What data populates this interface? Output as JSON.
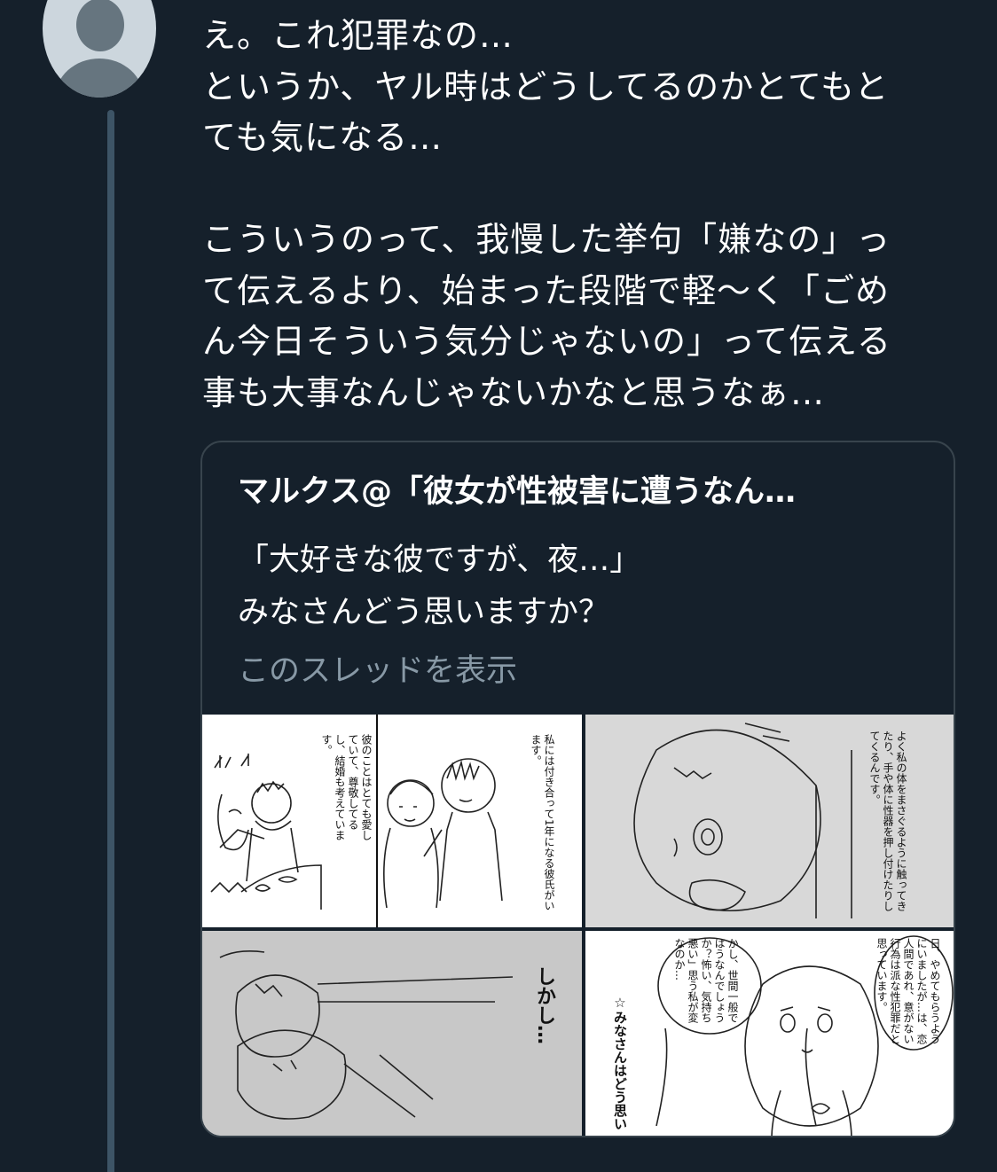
{
  "tweet": {
    "text": "え。これ犯罪なの…\nというか、ヤル時はどうしてるのかとてもと\nても気になる…\n\nこういうのって、我慢した挙句「嫌なの」っ\nて伝えるより、始まった段階で軽〜く「ごめ\nん今日そういう気分じゃないの」って伝える\n事も大事なんじゃないかなと思うなぁ…"
  },
  "quote": {
    "author": "マルクス@「彼女が性被害に遭うなん…",
    "text": "「大好きな彼ですが、夜…」\nみなさんどう思いますか？",
    "show_thread": "このスレッドを表示"
  },
  "manga": {
    "panel1_caption_a": "私には付き合って1年になる彼氏がいます。",
    "panel1_caption_b": "彼のことはとても愛していて、尊敬してるし、結婚も考えています。",
    "panel2_caption": "よく私の体をまさぐるように触ってきたり、手や体に性器を押し付けたりしてくるんです。",
    "panel3_caption": "しかし…",
    "panel4_caption_a": "日、やめてもらうようにいましたが…は、恋人間であれ、意がない行為は派な性犯罪だと思っています。",
    "panel4_caption_b": "かし、世間一般ではうなんでしょうか？怖い、気持ち悪い」思う私が変なのか…",
    "panel4_caption_c": "☆みなさんはどう思い"
  },
  "colors": {
    "background": "#15202b",
    "border": "#38444d",
    "secondary_text": "#8899a6",
    "thread_line": "#3d5466"
  }
}
